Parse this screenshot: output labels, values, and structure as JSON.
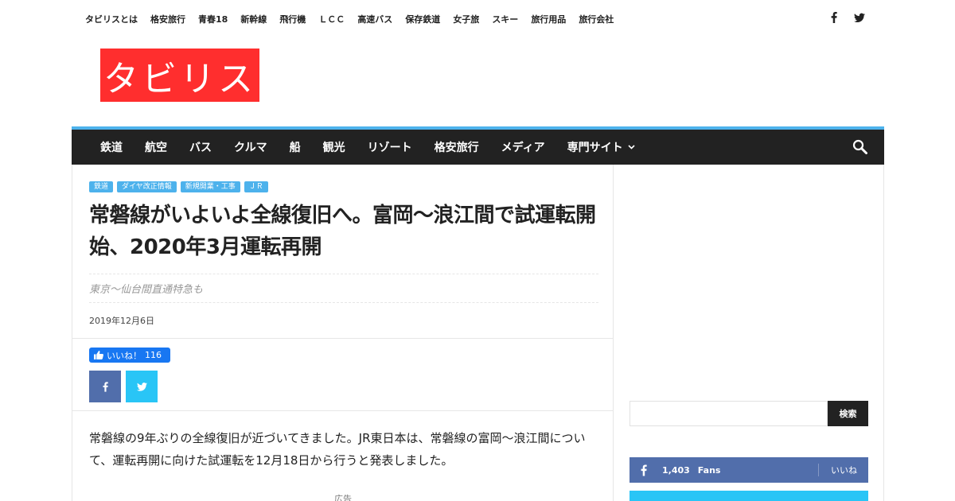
{
  "top_menu": [
    "タビリスとは",
    "格安旅行",
    "青春18",
    "新幹線",
    "飛行機",
    "ＬＣＣ",
    "高速バス",
    "保存鉄道",
    "女子旅",
    "スキー",
    "旅行用品",
    "旅行会社"
  ],
  "logo": "タビリス",
  "main_nav": [
    "鉄道",
    "航空",
    "バス",
    "クルマ",
    "船",
    "観光",
    "リゾート",
    "格安旅行",
    "メディア",
    "専門サイト"
  ],
  "article": {
    "categories": [
      "鉄道",
      "ダイヤ改正情報",
      "新規開業・工事",
      "ＪＲ"
    ],
    "title": "常磐線がいよいよ全線復旧へ。富岡～浪江間で試運転開始、2020年3月運転再開",
    "subtitle": "東京～仙台間直通特急も",
    "date": "2019年12月6日",
    "like_label": "いいね！",
    "like_count": "116",
    "body": "常磐線の9年ぶりの全線復旧が近づいてきました。JR東日本は、常磐線の富岡～浪江間について、運転再開に向けた試運転を12月18日から行うと発表しました。",
    "ad_label": "広告"
  },
  "sidebar": {
    "search_button": "検索",
    "facebook": {
      "count": "1,403",
      "label": "Fans",
      "action": "いいね"
    }
  },
  "colors": {
    "accent": "#4db2ec",
    "logo_bg": "#ff2e2e",
    "nav_bg": "#222222",
    "facebook": "#516eab",
    "twitter": "#29c5f6"
  }
}
